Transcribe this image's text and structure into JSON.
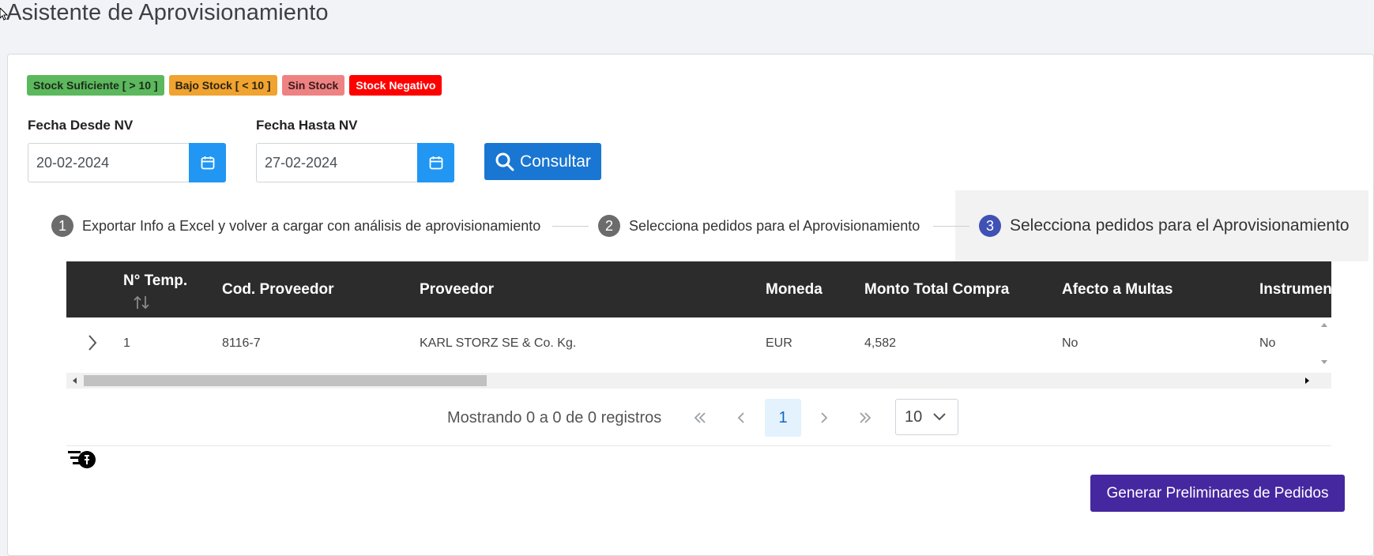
{
  "page_title": "Asistente de Aprovisionamiento",
  "legend": {
    "sufficient": "Stock Suficiente [ > 10 ]",
    "low": "Bajo Stock [ < 10 ]",
    "none": "Sin Stock",
    "negative": "Stock Negativo"
  },
  "filters": {
    "from_label": "Fecha Desde NV",
    "from_value": "20-02-2024",
    "to_label": "Fecha Hasta NV",
    "to_value": "27-02-2024",
    "consult_label": "Consultar"
  },
  "steps": [
    {
      "num": "1",
      "label": "Exportar Info a Excel y volver a cargar con análisis de aprovisionamiento"
    },
    {
      "num": "2",
      "label": "Selecciona pedidos para el Aprovisionamiento"
    },
    {
      "num": "3",
      "label": "Selecciona pedidos para el Aprovisionamiento"
    }
  ],
  "table": {
    "columns": [
      "N° Temp.",
      "Cod. Proveedor",
      "Proveedor",
      "Moneda",
      "Monto Total Compra",
      "Afecto a Multas",
      "Instrumen"
    ],
    "rows": [
      {
        "temp": "1",
        "cod": "8116-7",
        "proveedor": "KARL STORZ SE & Co. Kg.",
        "moneda": "EUR",
        "monto": "4,582",
        "multas": "No",
        "instrumento": "No"
      }
    ]
  },
  "paginator": {
    "info": "Mostrando 0 a 0 de 0 registros",
    "current_page": "1",
    "page_size": "10"
  },
  "generate_label": "Generar Preliminares de Pedidos",
  "colors": {
    "accent": "#1976d2",
    "calendar": "#2196f3",
    "step_active": "#3f51b5",
    "generate": "#4527a0",
    "table_header": "#2c2c2c"
  }
}
